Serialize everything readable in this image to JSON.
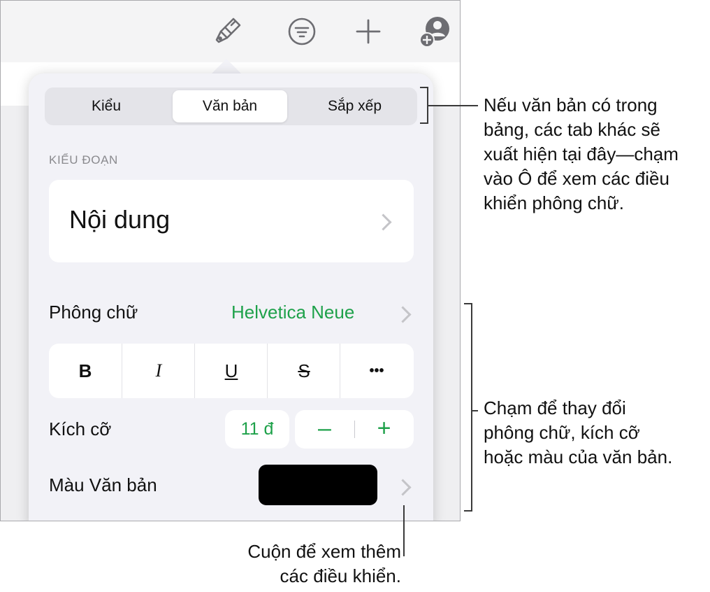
{
  "toolbar": {
    "icons": [
      "paintbrush-icon",
      "filter-icon",
      "plus-icon",
      "collaborate-icon"
    ]
  },
  "tabs": [
    {
      "label": "Kiểu",
      "active": false
    },
    {
      "label": "Văn bản",
      "active": true
    },
    {
      "label": "Sắp xếp",
      "active": false
    }
  ],
  "paragraph_style": {
    "header": "KIỂU ĐOẠN",
    "value": "Nội dung"
  },
  "font": {
    "label": "Phông chữ",
    "value": "Helvetica Neue"
  },
  "format_buttons": [
    {
      "label": "B",
      "name": "bold-button"
    },
    {
      "label": "I",
      "name": "italic-button"
    },
    {
      "label": "U",
      "name": "underline-button"
    },
    {
      "label": "S",
      "name": "strikethrough-button"
    },
    {
      "label": "•••",
      "name": "more-options-button"
    }
  ],
  "size": {
    "label": "Kích cỡ",
    "value": "11 đ",
    "decrement": "–",
    "increment": "+"
  },
  "text_color": {
    "label": "Màu Văn bản",
    "swatch": "#000000"
  },
  "colors": {
    "accent": "#1ea14a",
    "toolbar_icon": "#6d6d72"
  },
  "callouts": {
    "tabs": [
      "Nếu văn bản có trong",
      "bảng, các tab khác sẽ",
      "xuất hiện tại đây—chạm",
      "vào Ô để xem các điều",
      "khiển phông chữ."
    ],
    "font_controls": [
      "Chạm để thay đổi",
      "phông chữ, kích cỡ",
      "hoặc màu của văn bản."
    ],
    "scroll": [
      "Cuộn để xem thêm",
      "các điều khiển."
    ]
  }
}
